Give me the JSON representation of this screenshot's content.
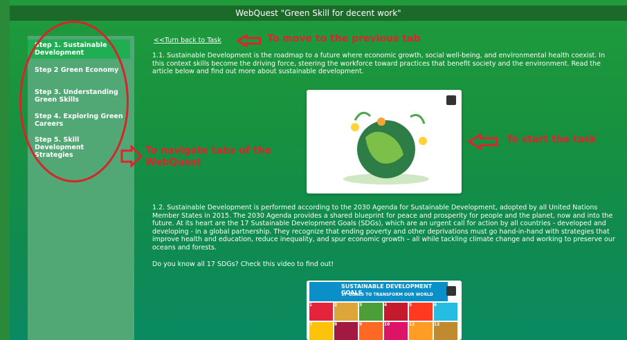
{
  "title": "WebQuest \"Green Skill for decent work\"",
  "sidebar": {
    "items": [
      {
        "label": "Step 1. Sustainable Development",
        "active": true
      },
      {
        "label": "Step 2 Green Economy",
        "active": false
      },
      {
        "label": "Step 3. Understanding Green Skills",
        "active": false
      },
      {
        "label": "Step 4. Exploring Green Careers",
        "active": false
      },
      {
        "label": "Step 5. Skill Development Strategies",
        "active": false
      }
    ]
  },
  "main": {
    "back_link": "<<Turn back to Task",
    "para1": "1.1. Sustainable Development is the roadmap to a future where economic growth, social well-being, and environmental health coexist. In this context skills become the driving force, steering the workforce toward practices that benefit society and the environment. Read the article below and find out more about sustainable development.",
    "para2": "1.2. Sustainable Development is performed according to the 2030 Agenda for Sustainable Development, adopted by all United Nations Member States in 2015. The 2030 Agenda provides a shared blueprint for peace and prosperity for people and the planet, now and into the future. At its heart are the 17 Sustainable Development Goals (SDGs), which are an urgent call for action by all countries - developed and developing - in a global partnership. They recognize that ending poverty and other deprivations must go hand-in-hand with strategies that improve health and education, reduce inequality, and spur economic growth – all while tackling climate change and working to preserve our oceans and forests.",
    "para3": "Do you know all 17 SDGs? Check this video to find out!",
    "sdg_title": "SUSTAINABLE DEVELOPMENT GOALS",
    "sdg_subtitle": "17 GOALS TO TRANSFORM OUR WORLD"
  },
  "annotations": {
    "prev_tab": "To move to the previous tab",
    "start_task": "To start the task",
    "navigate_tabs": "To navigate tabs of the WebQuest"
  },
  "colors": {
    "annotation": "#e0232b",
    "sidebar_bg": "#52a874",
    "active_item": "#1fae52"
  }
}
